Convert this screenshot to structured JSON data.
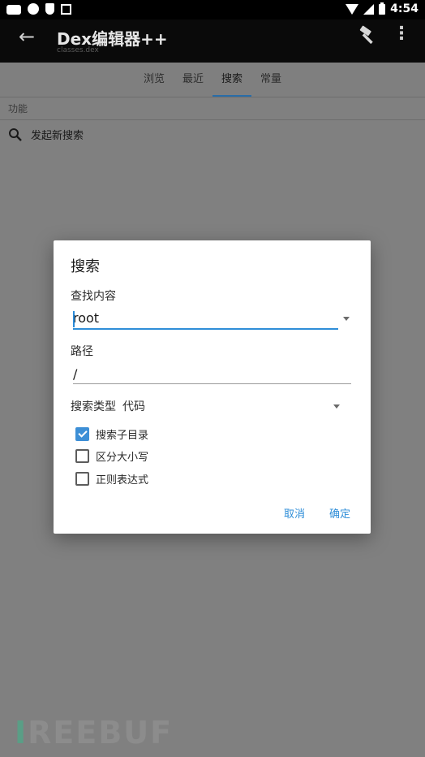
{
  "status_bar": {
    "time": "4:54",
    "icons": [
      "keyboard-icon",
      "app-icon",
      "shield-icon",
      "notification-icon",
      "wifi-icon",
      "signal-icon",
      "battery-icon"
    ]
  },
  "app_bar": {
    "title": "Dex编辑器++",
    "subtitle": "classes.dex",
    "icons": [
      "back-arrow-icon",
      "hammer-icon",
      "more-vert-icon"
    ]
  },
  "tabs": [
    {
      "label": "浏览",
      "active": false
    },
    {
      "label": "最近",
      "active": false
    },
    {
      "label": "搜索",
      "active": true
    },
    {
      "label": "常量",
      "active": false
    }
  ],
  "section": {
    "label": "功能",
    "items": [
      {
        "label": "发起新搜索",
        "icon": "search-icon"
      }
    ]
  },
  "dialog": {
    "title": "搜索",
    "find_label": "查找内容",
    "find_value": "root",
    "path_label": "路径",
    "path_value": "/",
    "type_label": "搜索类型",
    "type_value": "代码",
    "checkboxes": [
      {
        "label": "搜索子目录",
        "checked": true
      },
      {
        "label": "区分大小写",
        "checked": false
      },
      {
        "label": "正则表达式",
        "checked": false
      }
    ],
    "cancel": "取消",
    "confirm": "确定"
  },
  "watermark": {
    "prefix": "I",
    "text": "REEBUF"
  },
  "colors": {
    "accent": "#2f8ed8",
    "checkbox": "#3d8fd6",
    "tab_indicator": "#2a6ea8"
  }
}
